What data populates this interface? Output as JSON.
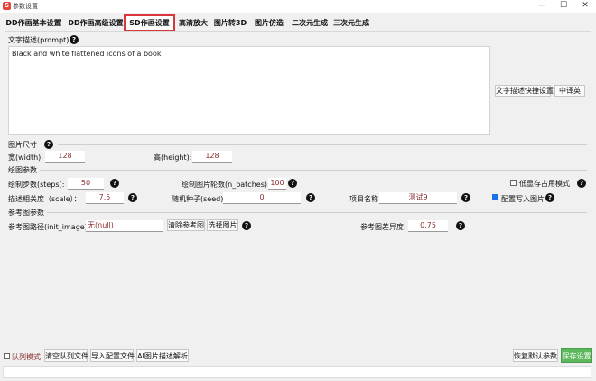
{
  "window": {
    "title": "参数设置",
    "minimize": "—",
    "maximize": "☐",
    "close": "✕"
  },
  "tabs": [
    {
      "label": "DD作画基本设置"
    },
    {
      "label": "DD作画高级设置"
    },
    {
      "label": "SD作画设置"
    },
    {
      "label": "高清放大"
    },
    {
      "label": "图片转3D"
    },
    {
      "label": "图片仿造"
    },
    {
      "label": "二次元生成"
    },
    {
      "label": "三次元生成"
    }
  ],
  "prompt": {
    "label": "文字描述(prompt)",
    "value": "Black and white flattened icons of a book",
    "quick_settings_button": "文字描述快捷设置",
    "translate_button": "中译英"
  },
  "image_size": {
    "section": "图片尺寸",
    "width_label": "宽(width):",
    "width_value": "128",
    "height_label": "高(height):",
    "height_value": "128"
  },
  "draw_params": {
    "section": "绘图参数",
    "steps_label": "绘制步数(steps):",
    "steps_value": "50",
    "batches_label": "绘制图片轮数(n_batches):",
    "batches_value": "100",
    "low_vram_label": "低显存占用模式",
    "scale_label": "描述相关度（scale）：",
    "scale_value": "7.5",
    "seed_label": "随机种子(seed):",
    "seed_value": "0",
    "project_label": "项目名称",
    "project_value": "测试9",
    "write_config_label": "配置写入图片"
  },
  "ref_params": {
    "section": "参考图参数",
    "init_image_label": "参考图路径(init_image):",
    "init_image_value": "无(null)",
    "clear_button": "清除参考图",
    "choose_button": "选择图片",
    "diff_label": "参考图差异度:",
    "diff_value": "0.75"
  },
  "bottom": {
    "queue_mode_label": "队列模式",
    "clear_queue_button": "清空队列文件",
    "import_config_button": "导入配置文件",
    "ai_parse_button": "AI图片描述解析",
    "restore_defaults_button": "恢复默认参数",
    "save_button": "保存设置"
  },
  "help_glyph": "?"
}
